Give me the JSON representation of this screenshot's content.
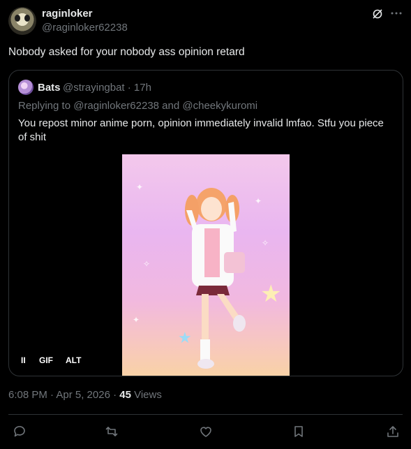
{
  "author": {
    "display_name": "raginloker",
    "handle": "@raginloker62238"
  },
  "tweet": {
    "text": "Nobody asked for your nobody ass opinion retard"
  },
  "quoted": {
    "display_name": "Bats",
    "handle_time": "@strayingbat · 17h",
    "replying_to": "Replying to @raginloker62238 and @cheekykuromi",
    "text": "You repost minor anime porn, opinion immediately invalid lmfao. Stfu you piece of shit",
    "media": {
      "pause_glyph": "II",
      "gif_label": "GIF",
      "alt_label": "ALT"
    }
  },
  "meta": {
    "timestamp": "6:08 PM · Apr 5, 2026 · ",
    "views_count": "45",
    "views_label": " Views"
  },
  "icons": {
    "grok": "grok-icon",
    "more": "more-icon",
    "reply": "reply-icon",
    "repost": "repost-icon",
    "like": "like-icon",
    "bookmark": "bookmark-icon",
    "share": "share-icon"
  },
  "colors": {
    "background": "#000000",
    "primary_text": "#e7e9ea",
    "secondary_text": "#71767b",
    "border": "#2f3336"
  }
}
